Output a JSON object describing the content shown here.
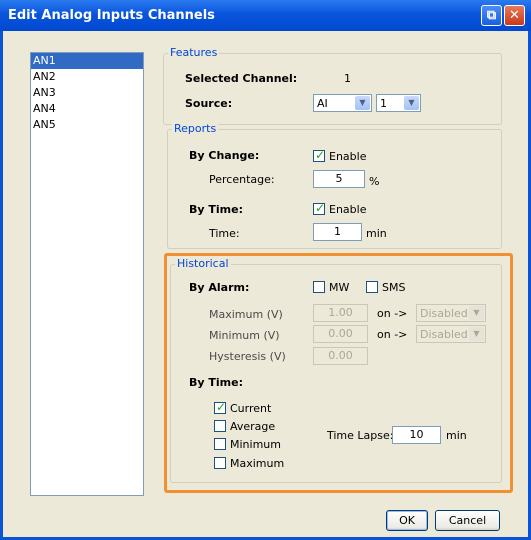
{
  "window": {
    "title": "Edit Analog Inputs Channels",
    "buttons": [
      "maximize-icon",
      "close-icon"
    ],
    "accent_color": "#0a52d6",
    "highlight_color": "#f09030"
  },
  "channels": [
    "AN1",
    "AN2",
    "AN3",
    "AN4",
    "AN5"
  ],
  "selected_channel_index": 0,
  "features": {
    "legend": "Features",
    "selected_channel_label": "Selected Channel:",
    "selected_channel_value": "1",
    "source_label": "Source:",
    "source_type": "AI",
    "source_number": "1"
  },
  "reports": {
    "legend": "Reports",
    "by_change_label": "By Change:",
    "by_change_enable_label": "Enable",
    "by_change_enabled": true,
    "percentage_label": "Percentage:",
    "percentage_value": "5",
    "percentage_unit": "%",
    "by_time_label": "By Time:",
    "by_time_enable_label": "Enable",
    "by_time_enabled": true,
    "time_label": "Time:",
    "time_value": "1",
    "time_unit": "min"
  },
  "historical": {
    "legend": "Historical",
    "by_alarm_label": "By Alarm:",
    "mw_label": "MW",
    "mw_checked": false,
    "sms_label": "SMS",
    "sms_checked": false,
    "maximum_label": "Maximum (V)",
    "maximum_value": "1.00",
    "maximum_on": "on ->",
    "maximum_action": "Disabled",
    "minimum_label": "Minimum (V)",
    "minimum_value": "0.00",
    "minimum_on": "on ->",
    "minimum_action": "Disabled",
    "hysteresis_label": "Hysteresis (V)",
    "hysteresis_value": "0.00",
    "by_time_label": "By Time:",
    "current_label": "Current",
    "current_checked": true,
    "average_label": "Average",
    "average_checked": false,
    "minimum_cb_label": "Minimum",
    "minimum_cb_checked": false,
    "maximum_cb_label": "Maximum",
    "maximum_cb_checked": false,
    "time_lapse_label": "Time Lapse:",
    "time_lapse_value": "10",
    "time_lapse_unit": "min"
  },
  "dialog_buttons": {
    "ok": "OK",
    "cancel": "Cancel"
  }
}
